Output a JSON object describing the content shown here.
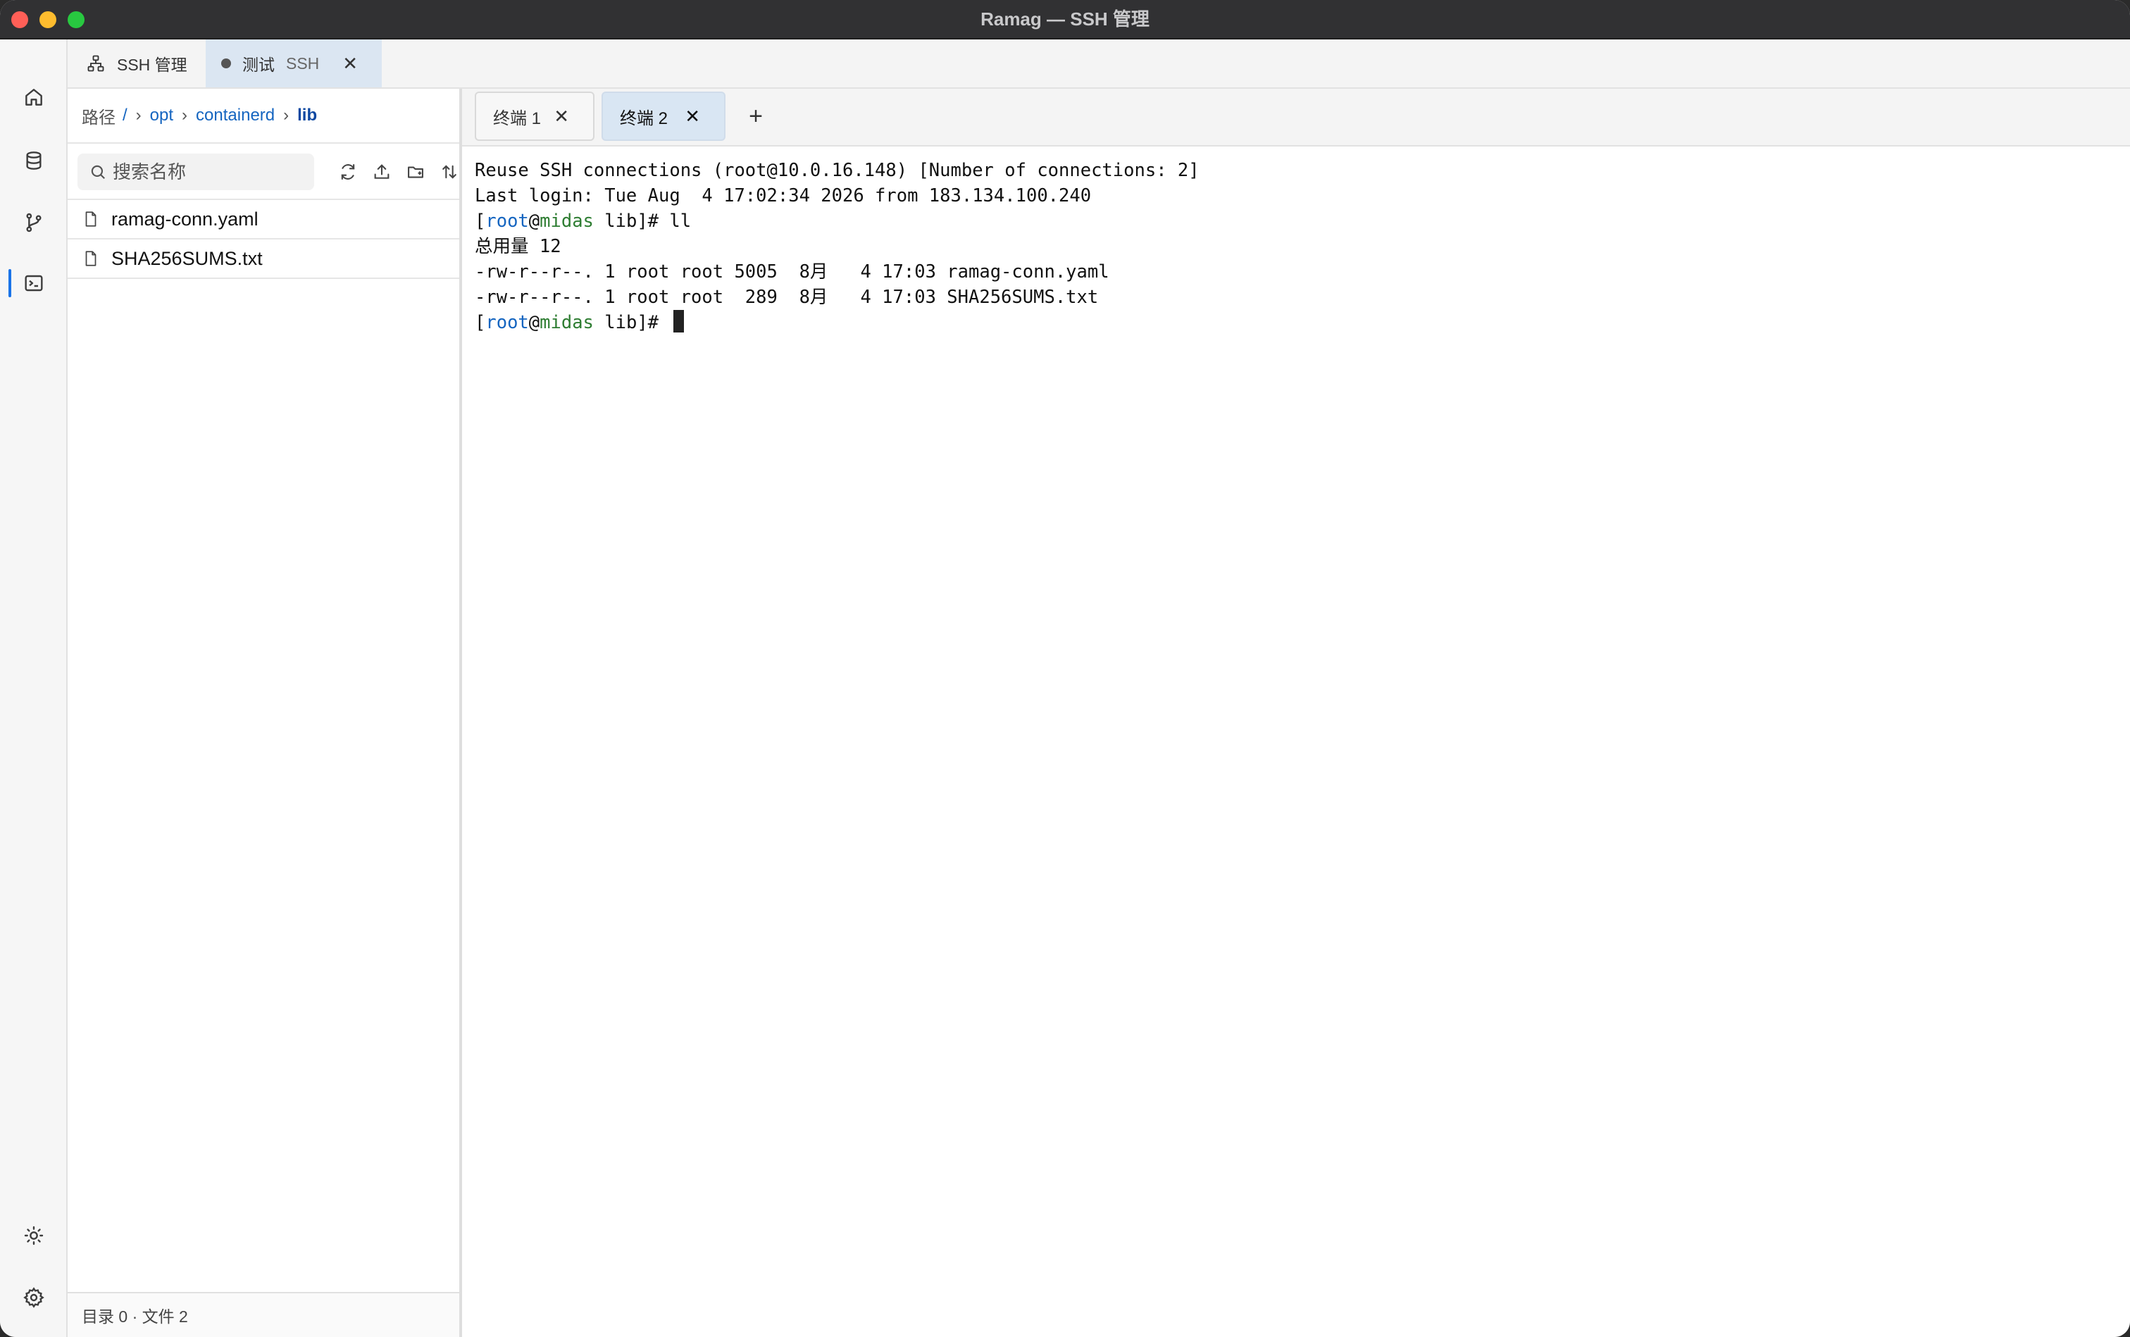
{
  "window": {
    "title": "Ramag — SSH 管理"
  },
  "top_tabs": [
    {
      "label": "SSH 管理",
      "icon": "network-icon"
    },
    {
      "label": "测试",
      "sub": "SSH",
      "icon": "dot-icon",
      "close": "✕"
    }
  ],
  "activity": [
    "home-icon",
    "database-icon",
    "git-branch-icon",
    "terminal-icon",
    "theme-sun-icon",
    "settings-gear-icon"
  ],
  "breadcrumb": {
    "label": "路径",
    "root": "/",
    "parts": [
      "opt",
      "containerd"
    ],
    "current": "lib",
    "sep": "›"
  },
  "search": {
    "placeholder": "搜索名称",
    "value": ""
  },
  "toolbar_icons": [
    "refresh-icon",
    "upload-icon",
    "new-folder-icon",
    "sort-icon"
  ],
  "files": [
    {
      "name": "ramag-conn.yaml"
    },
    {
      "name": "SHA256SUMS.txt"
    }
  ],
  "status": {
    "text": "目录 0 · 文件 2"
  },
  "terminal_tabs": [
    {
      "label": "终端 1",
      "close": "✕"
    },
    {
      "label": "终端 2",
      "close": "✕"
    }
  ],
  "add_terminal": "+",
  "terminal": {
    "line1": "Reuse SSH connections (root@10.0.16.148) [Number of connections: 2]",
    "line2": "Last login: Tue Aug  4 17:02:34 2026 from 183.134.100.240",
    "prompt_open": "[",
    "prompt_user": "root",
    "prompt_at": "@",
    "prompt_host": "midas",
    "prompt_tail": " lib]# ",
    "command": "ll",
    "line4": "总用量 12",
    "line5": "-rw-r--r--. 1 root root 5005  8月   4 17:03 ramag-conn.yaml",
    "line6": "-rw-r--r--. 1 root root  289  8月   4 17:03 SHA256SUMS.txt"
  },
  "colors": {
    "accent": "#1565c0",
    "host": "#2e7d32",
    "active_tab": "#dbe6f2"
  }
}
